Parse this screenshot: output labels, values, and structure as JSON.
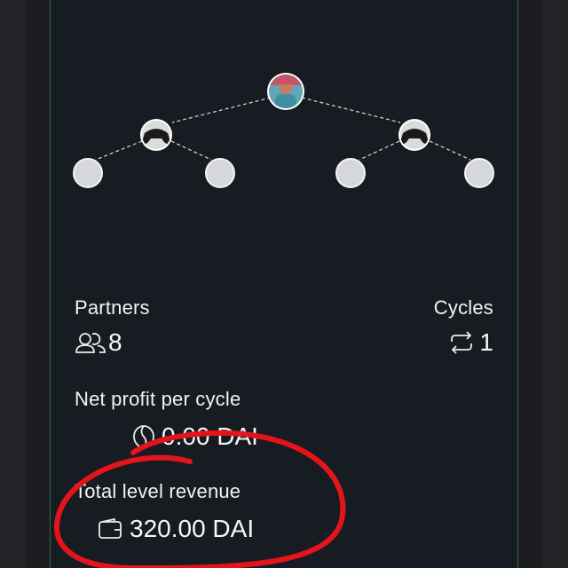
{
  "matrix": {
    "partners_label": "Partners",
    "partners_count": "8",
    "cycles_label": "Cycles",
    "cycles_count": "1",
    "net_profit_label": "Net profit per cycle",
    "net_profit_value": "0.00 DAI",
    "revenue_label": "Total level revenue",
    "revenue_value": "320.00 DAI"
  },
  "icons": {
    "partners": "people-icon",
    "cycles": "repeat-icon",
    "net_profit": "coin-icon",
    "revenue": "wallet-icon",
    "root": "user-avatar",
    "level1": "gamepad-avatar"
  },
  "colors": {
    "panel_bg": "#161c21",
    "empty_slot": "#d5d7da",
    "annotation_red": "#e3141c",
    "panel_border": "#2f6b43"
  }
}
